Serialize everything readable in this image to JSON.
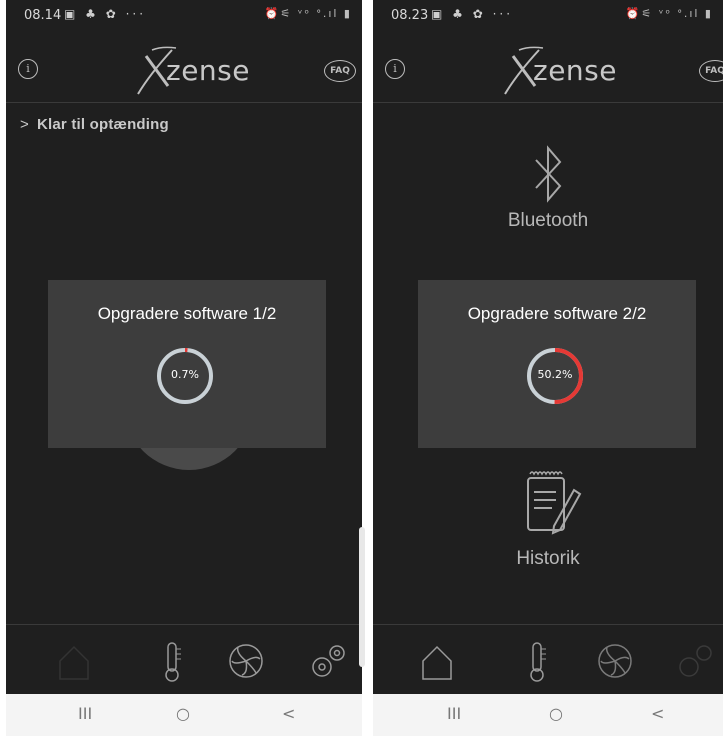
{
  "left": {
    "status": {
      "time": "08.14",
      "icons": "▣ ♣ ✿ ···",
      "right": "⏰⚟ ᵛᵒ ᐤ.ıl ▮"
    },
    "logo_text": "zense",
    "faq_label": "FAQ",
    "ready_text": "Klar til optænding",
    "dialog": {
      "title": "Opgradere software 1/2",
      "progress_label": "0.7%",
      "progress_value": 0.007
    }
  },
  "right": {
    "status": {
      "time": "08.23",
      "icons": "▣ ♣ ✿ ···",
      "right": "⏰⚟ ᵛᵒ ᐤ.ıl ▮"
    },
    "logo_text": "zense",
    "faq_label": "FAQ",
    "bluetooth_label": "Bluetooth",
    "historik_label": "Historik",
    "dialog": {
      "title": "Opgradere software 2/2",
      "progress_label": "50.2%",
      "progress_value": 0.502
    }
  },
  "sysnav": {
    "recent": "III",
    "home": "○",
    "back": "<"
  },
  "colors": {
    "accent": "#e53935",
    "track": "#c9d1d6",
    "dialog_bg": "#3d3d3d",
    "screen_bg": "#1f1f1f"
  },
  "icons": [
    "info-icon",
    "xzense-logo",
    "faq-icon",
    "chevron-right-icon",
    "bluetooth-icon",
    "notepad-pencil-icon",
    "home-icon",
    "thermometer-icon",
    "fan-icon",
    "gears-icon"
  ]
}
